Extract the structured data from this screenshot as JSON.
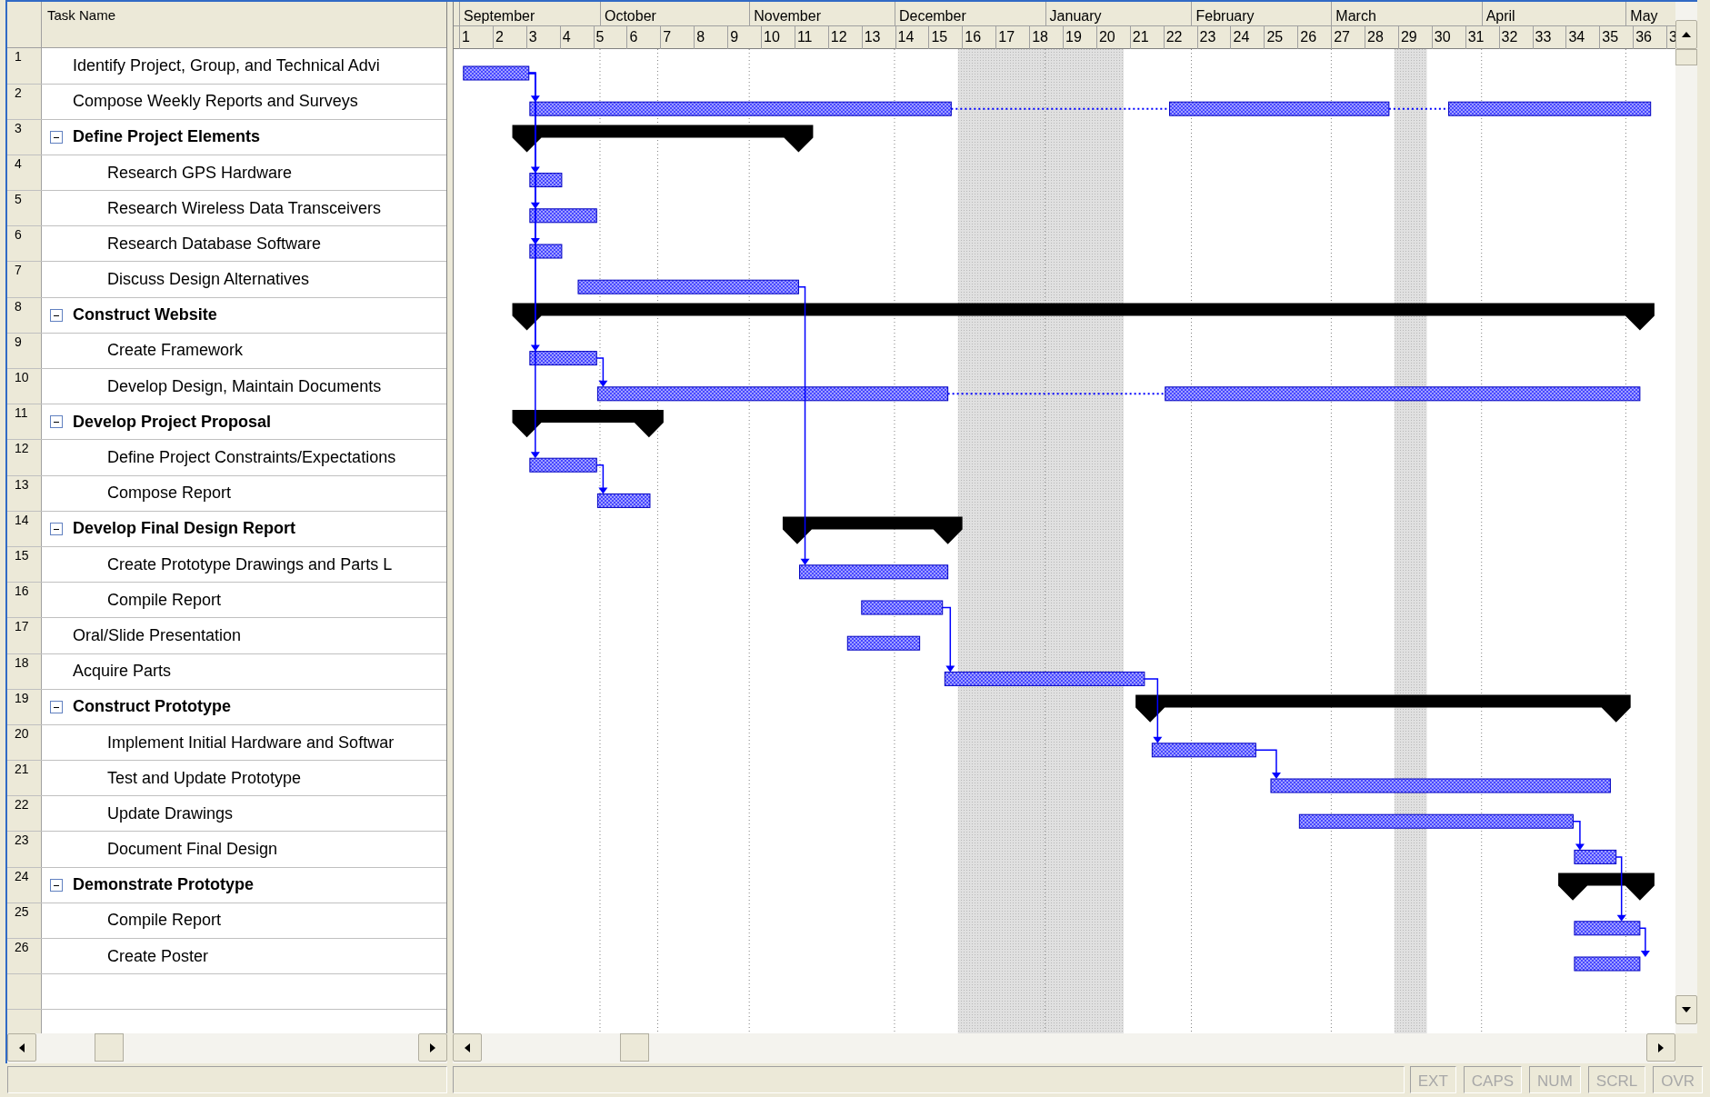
{
  "table": {
    "columns": [
      "Task Name"
    ],
    "tasks": [
      {
        "id": "1",
        "name": "Identify Project, Group, and Technical Advi",
        "kind": "task"
      },
      {
        "id": "2",
        "name": "Compose Weekly Reports and Surveys",
        "kind": "task"
      },
      {
        "id": "3",
        "name": "Define Project Elements",
        "kind": "summary",
        "expanded": true,
        "children": [
          {
            "id": "4",
            "name": "Research GPS Hardware",
            "kind": "task"
          },
          {
            "id": "5",
            "name": "Research Wireless Data Transceivers",
            "kind": "task"
          },
          {
            "id": "6",
            "name": "Research Database Software",
            "kind": "task"
          },
          {
            "id": "7",
            "name": "Discuss Design Alternatives",
            "kind": "task"
          }
        ]
      },
      {
        "id": "8",
        "name": "Construct Website",
        "kind": "summary",
        "expanded": true,
        "children": [
          {
            "id": "9",
            "name": "Create Framework",
            "kind": "task"
          },
          {
            "id": "10",
            "name": "Develop Design, Maintain Documents",
            "kind": "task"
          }
        ]
      },
      {
        "id": "11",
        "name": "Develop Project Proposal",
        "kind": "summary",
        "expanded": true,
        "children": [
          {
            "id": "12",
            "name": "Define Project Constraints/Expectations",
            "kind": "task"
          },
          {
            "id": "13",
            "name": "Compose Report",
            "kind": "task"
          }
        ]
      },
      {
        "id": "14",
        "name": "Develop Final Design Report",
        "kind": "summary",
        "expanded": true,
        "children": [
          {
            "id": "15",
            "name": "Create Prototype Drawings and Parts L",
            "kind": "task"
          },
          {
            "id": "16",
            "name": "Compile Report",
            "kind": "task"
          }
        ]
      },
      {
        "id": "17",
        "name": "Oral/Slide Presentation",
        "kind": "task"
      },
      {
        "id": "18",
        "name": "Acquire Parts",
        "kind": "task"
      },
      {
        "id": "19",
        "name": "Construct Prototype",
        "kind": "summary",
        "expanded": true,
        "children": [
          {
            "id": "20",
            "name": "Implement Initial Hardware and Softwar",
            "kind": "task"
          },
          {
            "id": "21",
            "name": "Test and Update Prototype",
            "kind": "task"
          },
          {
            "id": "22",
            "name": "Update Drawings",
            "kind": "task"
          },
          {
            "id": "23",
            "name": "Document Final Design",
            "kind": "task"
          }
        ]
      },
      {
        "id": "24",
        "name": "Demonstrate Prototype",
        "kind": "summary",
        "expanded": true,
        "children": [
          {
            "id": "25",
            "name": "Compile Report",
            "kind": "task"
          },
          {
            "id": "26",
            "name": "Create Poster",
            "kind": "task"
          }
        ]
      }
    ]
  },
  "timeline": {
    "months": [
      "September",
      "October",
      "November",
      "December",
      "January",
      "February",
      "March",
      "April",
      "May"
    ],
    "weeks": [
      "1",
      "2",
      "3",
      "4",
      "5",
      "6",
      "7",
      "8",
      "9",
      "10",
      "11",
      "12",
      "13",
      "14",
      "15",
      "16",
      "17",
      "18",
      "19",
      "20",
      "21",
      "22",
      "23",
      "24",
      "25",
      "26",
      "27",
      "28",
      "29",
      "30",
      "31",
      "32",
      "33",
      "34",
      "35",
      "36",
      "3"
    ]
  },
  "status_bar": {
    "indicators": [
      {
        "label": "EXT",
        "on": false
      },
      {
        "label": "CAPS",
        "on": false
      },
      {
        "label": "NUM",
        "on": false
      },
      {
        "label": "SCRL",
        "on": false
      },
      {
        "label": "OVR",
        "on": false
      }
    ]
  }
}
